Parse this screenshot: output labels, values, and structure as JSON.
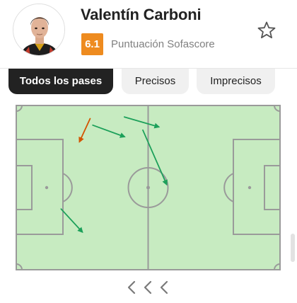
{
  "player": {
    "name": "Valentín Carboni",
    "rating": "6.1",
    "rating_label": "Puntuación Sofascore"
  },
  "tabs": [
    {
      "label": "Todos los pases",
      "active": true
    },
    {
      "label": "Precisos",
      "active": false
    },
    {
      "label": "Imprecisos",
      "active": false
    }
  ],
  "pitch": {
    "field_color": "#c7ebc1",
    "line_color": "#9a9a9a",
    "passes": [
      {
        "result": "inaccurate",
        "color": "#d35400",
        "from": [
          0.28,
          0.08
        ],
        "to": [
          0.24,
          0.22
        ]
      },
      {
        "result": "accurate",
        "color": "#1ca05a",
        "from": [
          0.29,
          0.12
        ],
        "to": [
          0.41,
          0.19
        ]
      },
      {
        "result": "accurate",
        "color": "#1ca05a",
        "from": [
          0.41,
          0.07
        ],
        "to": [
          0.54,
          0.13
        ]
      },
      {
        "result": "accurate",
        "color": "#1ca05a",
        "from": [
          0.48,
          0.15
        ],
        "to": [
          0.57,
          0.48
        ]
      },
      {
        "result": "accurate",
        "color": "#1ca05a",
        "from": [
          0.17,
          0.63
        ],
        "to": [
          0.25,
          0.77
        ]
      }
    ]
  },
  "colors": {
    "accent": "#222222",
    "rating": "#ee8b1f",
    "accurate": "#1ca05a",
    "inaccurate": "#d35400"
  },
  "icons": {
    "favorite": "star-outline-icon",
    "navigation": "chevron-left-icon"
  }
}
